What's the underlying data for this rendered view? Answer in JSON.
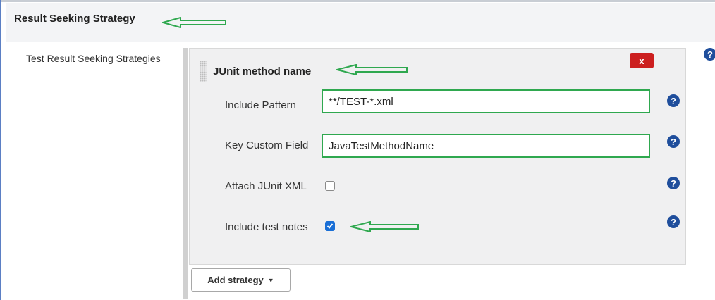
{
  "section": {
    "title": "Result Seeking Strategy"
  },
  "strategies": {
    "label": "Test Result Seeking Strategies",
    "help_icon": "?",
    "panel": {
      "title": "JUnit method name",
      "delete_label": "x",
      "fields": [
        {
          "label": "Include Pattern",
          "value": "**/TEST-*.xml",
          "help": "?"
        },
        {
          "label": "Key Custom Field",
          "value": "JavaTestMethodName",
          "help": "?"
        }
      ],
      "checkboxes": [
        {
          "label": "Attach JUnit XML",
          "checked": false,
          "help": "?"
        },
        {
          "label": "Include test notes",
          "checked": true,
          "help": "?"
        }
      ]
    },
    "add_button": {
      "label": "Add strategy",
      "caret": "▼"
    }
  },
  "colors": {
    "annotation_arrow": "#2fa84f",
    "delete_button": "#cc1f1f",
    "help_icon": "#1f4e9c",
    "checkbox_checked": "#1a6fd6"
  },
  "icons": [
    "arrow-annotation-icon",
    "drag-handle-icon",
    "help-icon",
    "check-icon",
    "caret-down-icon"
  ]
}
